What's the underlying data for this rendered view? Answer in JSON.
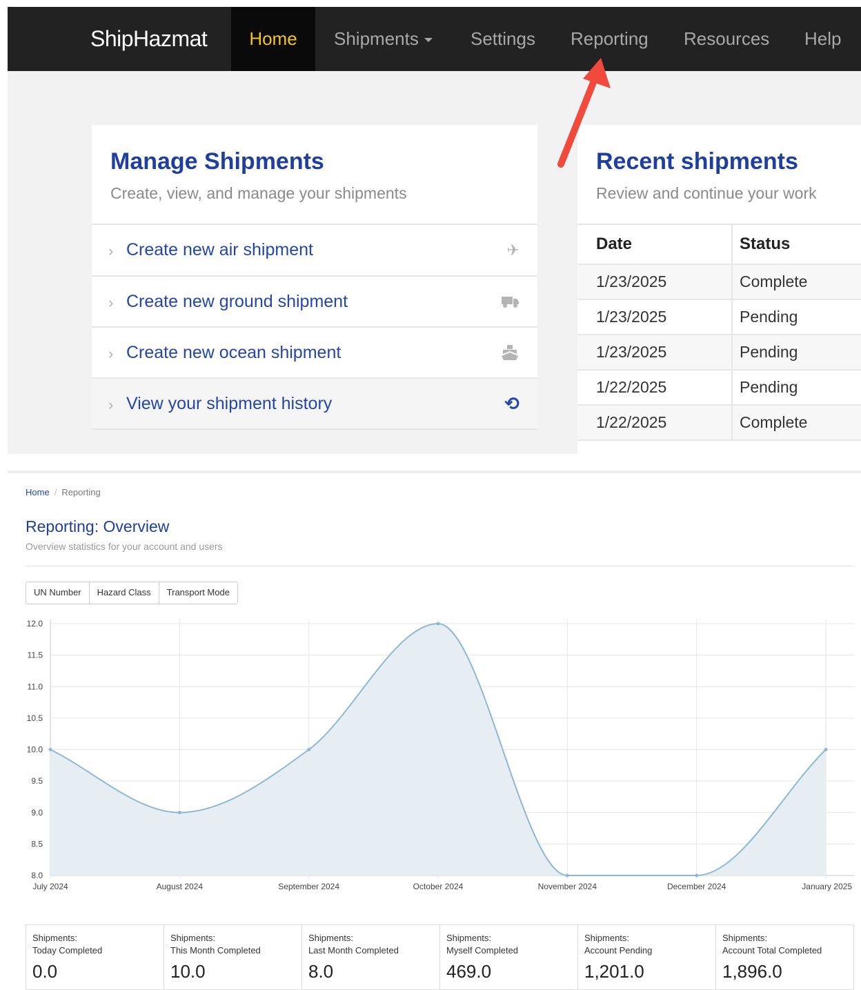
{
  "nav": {
    "brand": "ShipHazmat",
    "items": [
      {
        "label": "Home"
      },
      {
        "label": "Shipments"
      },
      {
        "label": "Settings"
      },
      {
        "label": "Reporting"
      },
      {
        "label": "Resources"
      },
      {
        "label": "Help"
      }
    ]
  },
  "manage": {
    "title": "Manage Shipments",
    "subtitle": "Create, view, and manage your shipments",
    "items": [
      {
        "label": "Create new air shipment",
        "icon": "plane-icon"
      },
      {
        "label": "Create new ground shipment",
        "icon": "truck-icon"
      },
      {
        "label": "Create new ocean shipment",
        "icon": "ship-icon"
      },
      {
        "label": "View your shipment history",
        "icon": "history-icon"
      }
    ]
  },
  "recent": {
    "title": "Recent shipments",
    "subtitle": "Review and continue your work",
    "columns": [
      "Date",
      "Status"
    ],
    "rows": [
      {
        "date": "1/23/2025",
        "status": "Complete"
      },
      {
        "date": "1/23/2025",
        "status": "Pending"
      },
      {
        "date": "1/23/2025",
        "status": "Pending"
      },
      {
        "date": "1/22/2025",
        "status": "Pending"
      },
      {
        "date": "1/22/2025",
        "status": "Complete"
      }
    ]
  },
  "reporting": {
    "breadcrumb": {
      "home": "Home",
      "current": "Reporting"
    },
    "title": "Reporting: Overview",
    "subtitle": "Overview statistics for your account and users",
    "filters": [
      "UN Number",
      "Hazard Class",
      "Transport Mode"
    ]
  },
  "chart_data": {
    "type": "area",
    "x": [
      "July 2024",
      "August 2024",
      "September 2024",
      "October 2024",
      "November 2024",
      "December 2024",
      "January 2025"
    ],
    "values": [
      10,
      9,
      10,
      12,
      8,
      8,
      10
    ],
    "yticks": [
      "12.0",
      "11.5",
      "11.0",
      "10.5",
      "10.0",
      "9.5",
      "9.0",
      "8.5",
      "8.0"
    ],
    "ylim": [
      8,
      12
    ],
    "grid": true,
    "line_color": "#8fb8d0",
    "fill_color": "#e7eef3"
  },
  "stats": [
    {
      "line1": "Shipments:",
      "line2": "Today Completed",
      "value": "0.0"
    },
    {
      "line1": "Shipments:",
      "line2": "This Month Completed",
      "value": "10.0"
    },
    {
      "line1": "Shipments:",
      "line2": "Last Month Completed",
      "value": "8.0"
    },
    {
      "line1": "Shipments:",
      "line2": "Myself Completed",
      "value": "469.0"
    },
    {
      "line1": "Shipments:",
      "line2": "Account Pending",
      "value": "1,201.0"
    },
    {
      "line1": "Shipments:",
      "line2": "Account Total Completed",
      "value": "1,896.0"
    }
  ],
  "colors": {
    "accent": "#1f3f9e",
    "annotation_arrow": "#f04a3c",
    "nav_active": "#f5c518"
  }
}
